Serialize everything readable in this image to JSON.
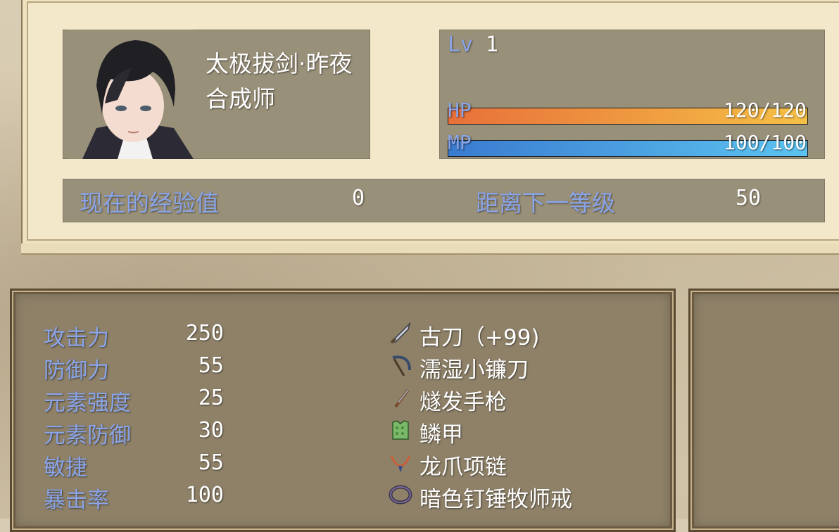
{
  "actor": {
    "name": "太极拔剑·昨夜",
    "class": "合成师",
    "level_label": "Lv",
    "level": "1",
    "hp_label": "HP",
    "hp_text": "120/120",
    "hp_fraction": 1.0,
    "mp_label": "MP",
    "mp_text": "100/100",
    "mp_fraction": 1.0
  },
  "exp": {
    "current_label": "现在的经验值",
    "current_value": "0",
    "next_label": "距离下一等级",
    "next_value": "50"
  },
  "params": [
    {
      "label": "攻击力",
      "value": "250"
    },
    {
      "label": "防御力",
      "value": "55"
    },
    {
      "label": "元素强度",
      "value": "25"
    },
    {
      "label": "元素防御",
      "value": "30"
    },
    {
      "label": "敏捷",
      "value": "55"
    },
    {
      "label": "暴击率",
      "value": "100"
    }
  ],
  "equipment": [
    {
      "name": "古刀（+99)",
      "icon": "dagger-icon"
    },
    {
      "name": "濡湿小镰刀",
      "icon": "sickle-icon"
    },
    {
      "name": "燧发手枪",
      "icon": "pistol-icon"
    },
    {
      "name": "鳞甲",
      "icon": "scale-armor-icon"
    },
    {
      "name": "龙爪项链",
      "icon": "necklace-icon"
    },
    {
      "name": "暗色钉锤牧师戒",
      "icon": "ring-icon"
    }
  ],
  "colors": {
    "system_blue": "#8aa4e8",
    "hp_gradient": [
      "#e8703a",
      "#f5c046"
    ],
    "mp_gradient": [
      "#3a7bd0",
      "#5cc4f0"
    ]
  }
}
